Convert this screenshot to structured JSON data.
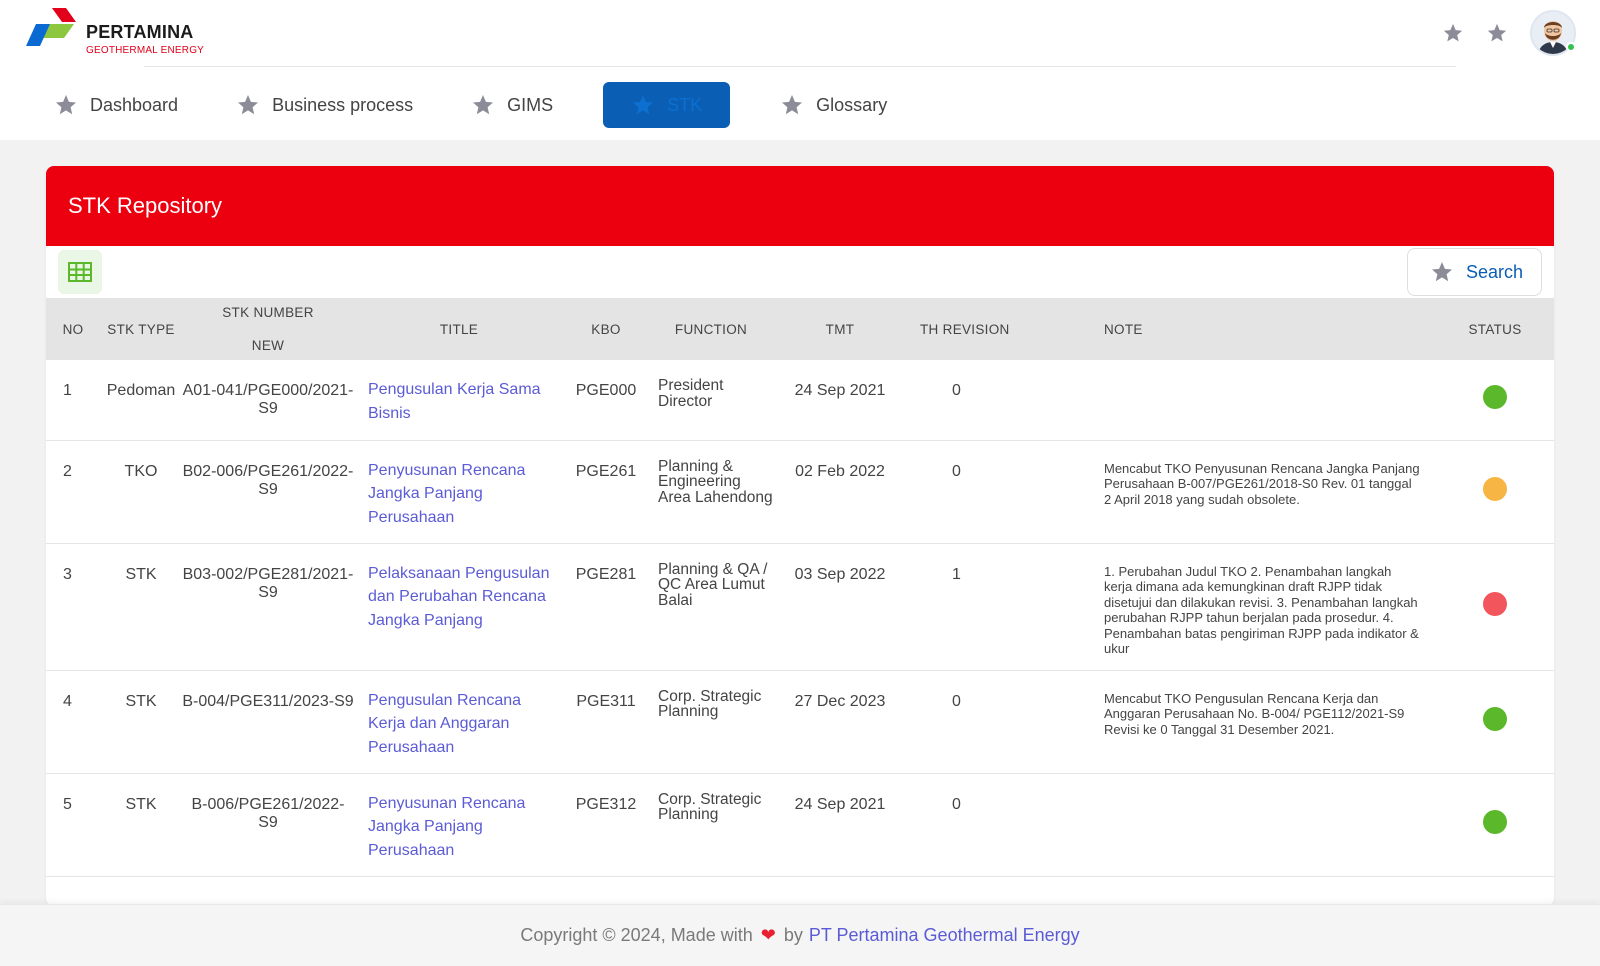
{
  "brand": {
    "name": "PERTAMINA",
    "subtitle": "GEOTHERMAL ENERGY",
    "colors": {
      "red": "#e3001b",
      "blue": "#0a6ad1",
      "green": "#8dc63f"
    }
  },
  "header": {
    "icons": [
      "star-icon",
      "star-icon"
    ],
    "user_status": "online"
  },
  "nav": {
    "items": [
      {
        "label": "Dashboard",
        "icon": "star-icon",
        "active": false
      },
      {
        "label": "Business process",
        "icon": "star-icon",
        "active": false
      },
      {
        "label": "GIMS",
        "icon": "star-icon",
        "active": false
      },
      {
        "label": "STK",
        "icon": "star-icon",
        "active": true
      },
      {
        "label": "Glossary",
        "icon": "star-icon",
        "active": false
      }
    ]
  },
  "card": {
    "title": "STK Repository",
    "header_color": "#ec0010",
    "toolbar": {
      "grid_icon": "table-grid-icon",
      "search_label": "Search",
      "search_icon": "star-icon"
    }
  },
  "table": {
    "columns": {
      "no": "NO",
      "stk_type": "STK TYPE",
      "stk_number": "STK NUMBER",
      "stk_number_sub": "NEW",
      "title": "TITLE",
      "kbo": "KBO",
      "function": "FUNCTION",
      "tmt": "TMT",
      "th_revision": "TH REVISION",
      "note": "NOTE",
      "status": "STATUS"
    },
    "rows": [
      {
        "no": "1",
        "stk_type": "Pedoman",
        "stk_number": "A01-041/PGE000/2021-S9",
        "title": "Pengusulan Kerja Sama Bisnis",
        "kbo": "PGE000",
        "function": "President Director",
        "tmt": "24 Sep 2021",
        "th_revision": "0",
        "note": "",
        "status_color": "#5bb82a"
      },
      {
        "no": "2",
        "stk_type": "TKO",
        "stk_number": "B02-006/PGE261/2022-S9",
        "title": "Penyusunan Rencana Jangka Panjang Perusahaan",
        "kbo": "PGE261",
        "function": "Planning & Engineering Area Lahendong",
        "tmt": "02 Feb 2022",
        "th_revision": "0",
        "note": "Mencabut TKO Penyusunan Rencana Jangka Panjang Perusahaan B-007/PGE261/2018-S0 Rev. 01 tanggal 2 April 2018 yang sudah obsolete.",
        "status_color": "#f7b543"
      },
      {
        "no": "3",
        "stk_type": "STK",
        "stk_number": "B03-002/PGE281/2021-S9",
        "title": "Pelaksanaan Pengusulan dan Perubahan Rencana Jangka Panjang",
        "kbo": "PGE281",
        "function": "Planning & QA / QC Area Lumut Balai",
        "tmt": "03 Sep 2022",
        "th_revision": "1",
        "note": "1. Perubahan Judul TKO 2. Penambahan langkah kerja dimana ada kemungkinan draft RJPP tidak disetujui dan dilakukan revisi. 3. Penambahan langkah perubahan RJPP tahun berjalan pada prosedur. 4. Penambahan batas pengiriman RJPP pada indikator & ukur",
        "status_color": "#f2565c"
      },
      {
        "no": "4",
        "stk_type": "STK",
        "stk_number": "B-004/PGE311/2023-S9",
        "title": "Pengusulan Rencana Kerja dan Anggaran Perusahaan",
        "kbo": "PGE311",
        "function": "Corp. Strategic Planning",
        "tmt": "27 Dec 2023",
        "th_revision": "0",
        "note": "Mencabut TKO Pengusulan Rencana Kerja dan Anggaran Perusahaan No. B-004/ PGE112/2021-S9 Revisi ke 0 Tanggal 31 Desember 2021.",
        "status_color": "#5bb82a"
      },
      {
        "no": "5",
        "stk_type": "STK",
        "stk_number": "B-006/PGE261/2022-S9",
        "title": "Penyusunan Rencana Jangka Panjang Perusahaan",
        "kbo": "PGE312",
        "function": "Corp. Strategic Planning",
        "tmt": "24 Sep 2021",
        "th_revision": "0",
        "note": "",
        "status_color": "#5bb82a"
      }
    ]
  },
  "footer": {
    "prefix": "Copyright © 2024, Made with",
    "heart": "❤",
    "by": "by",
    "company": "PT Pertamina Geothermal Energy"
  }
}
